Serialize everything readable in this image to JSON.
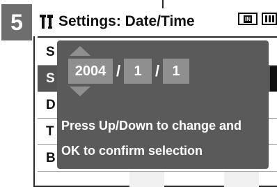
{
  "step": "5",
  "header": {
    "title": "Settings: Date/Time",
    "memory_label": "IN"
  },
  "menu": {
    "items": [
      {
        "label": "S"
      },
      {
        "label": "S"
      },
      {
        "label": "D"
      },
      {
        "label": "T"
      },
      {
        "label": "B"
      }
    ]
  },
  "dialog": {
    "year": "2004",
    "separator": "/",
    "month": "1",
    "day": "1",
    "help_line1": "Press Up/Down to change and",
    "help_line2": "OK to confirm selection"
  },
  "colors": {
    "badge": "#6e6e6e",
    "overlay": "#5a5a5a",
    "field": "#8f8f8f",
    "selected_row": "#555555"
  }
}
